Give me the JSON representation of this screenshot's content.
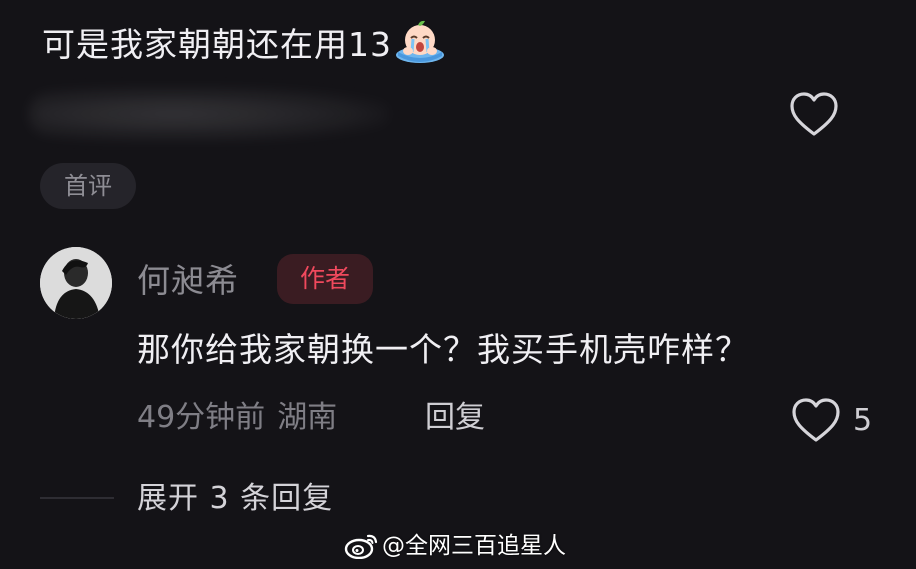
{
  "top_comment": {
    "text": "可是我家朝朝还在用13",
    "emoji": "crying-peach-emoji",
    "badge": "首评"
  },
  "reply": {
    "author_name": "何昶希",
    "author_tag": "作者",
    "text": "那你给我家朝换一个？我买手机壳咋样？",
    "time": "49分钟前",
    "location": "湖南",
    "reply_label": "回复",
    "like_count": "5"
  },
  "expand_replies": "展开 3 条回复",
  "watermark": "@全网三百追星人",
  "icons": {
    "heart": "heart-outline-icon",
    "weibo": "weibo-logo-icon"
  },
  "colors": {
    "background": "#141317",
    "author_tag_text": "#f0495d",
    "author_tag_bg": "#3a1c22"
  }
}
